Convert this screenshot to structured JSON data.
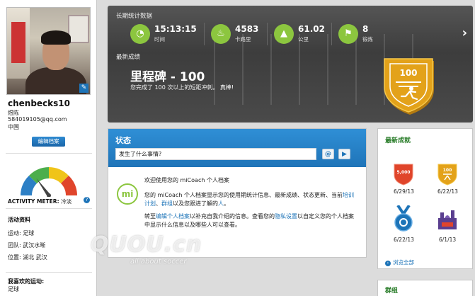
{
  "profile": {
    "username": "chenbecks10",
    "real_name": "煜陈",
    "email": "584019105@qq.com",
    "country": "中国",
    "edit_button": "编辑档案",
    "activity_meter_label": "ACTIVITY METER:",
    "activity_meter_value": "冷淡",
    "activity_level_text": "冷淡",
    "info_title": "活动资料",
    "sport": "运动: 足球",
    "team": "团队: 武汉水晰",
    "location": "位置: 湖北 武汉",
    "fav_title": "我喜欢的运动:",
    "fav_value": "足球"
  },
  "stats": {
    "title": "长期统计数据",
    "items": [
      {
        "value": "15:13:15",
        "label": "时间",
        "icon": "stopwatch-icon"
      },
      {
        "value": "4583",
        "label": "卡路里",
        "icon": "flame-icon"
      },
      {
        "value": "61.02",
        "label": "公里",
        "icon": "road-icon"
      },
      {
        "value": "8",
        "label": "锻炼",
        "icon": "runner-icon"
      }
    ],
    "latest_title": "最新成绩",
    "milestone_title": "里程碑 - 100",
    "milestone_desc": "您完成了 100 次以上的短距冲刺。",
    "milestone_cheer": "真棒!",
    "badge_number": "100",
    "badge_color": "#e3a21a"
  },
  "status": {
    "title": "状态",
    "placeholder": "发生了什么事情?",
    "at_button": "@",
    "post_button": "▶",
    "logo": "mi",
    "welcome": "欢迎使用您的 miCoach 个人档案",
    "p1_a": "您的 miCoach 个人档案显示您的使用期统计信息、最新成绩、状态更新、当前",
    "p1_link1": "培训计划",
    "p1_b": "、",
    "p1_link2": "群组",
    "p1_c": "以及您跟进了解的",
    "p1_link3": "人",
    "p1_d": "。",
    "p2_a": "转至",
    "p2_link1": "编辑个人档案",
    "p2_b": "以补充自我介绍的信息。查看您的",
    "p2_link2": "隐私设置",
    "p2_c": "以自定义您的个人档案中显示什么信息以及哪些人可以查看。"
  },
  "recent": {
    "title": "最新成就",
    "badges": [
      {
        "date": "6/29/13",
        "text": "5,000",
        "icon": "red-shield-badge-icon",
        "color": "#e0452b"
      },
      {
        "date": "6/22/13",
        "text": "100",
        "icon": "gold-shield-badge-icon",
        "color": "#e3a21a"
      },
      {
        "date": "6/22/13",
        "text": "",
        "icon": "blue-medal-badge-icon",
        "color": "#1d74b8"
      },
      {
        "date": "6/1/13",
        "text": "",
        "icon": "city-badge-icon",
        "color": "#5a3f8f"
      }
    ],
    "more": "浏览全部"
  },
  "groups": {
    "title": "群组"
  },
  "watermark": {
    "logo": "QUOU.cn",
    "slogan": "all about soccer"
  },
  "gauge": {
    "level": 0.3,
    "colors": [
      "#2c7fc5",
      "#4cae4c",
      "#f0c419",
      "#e0452b"
    ]
  }
}
